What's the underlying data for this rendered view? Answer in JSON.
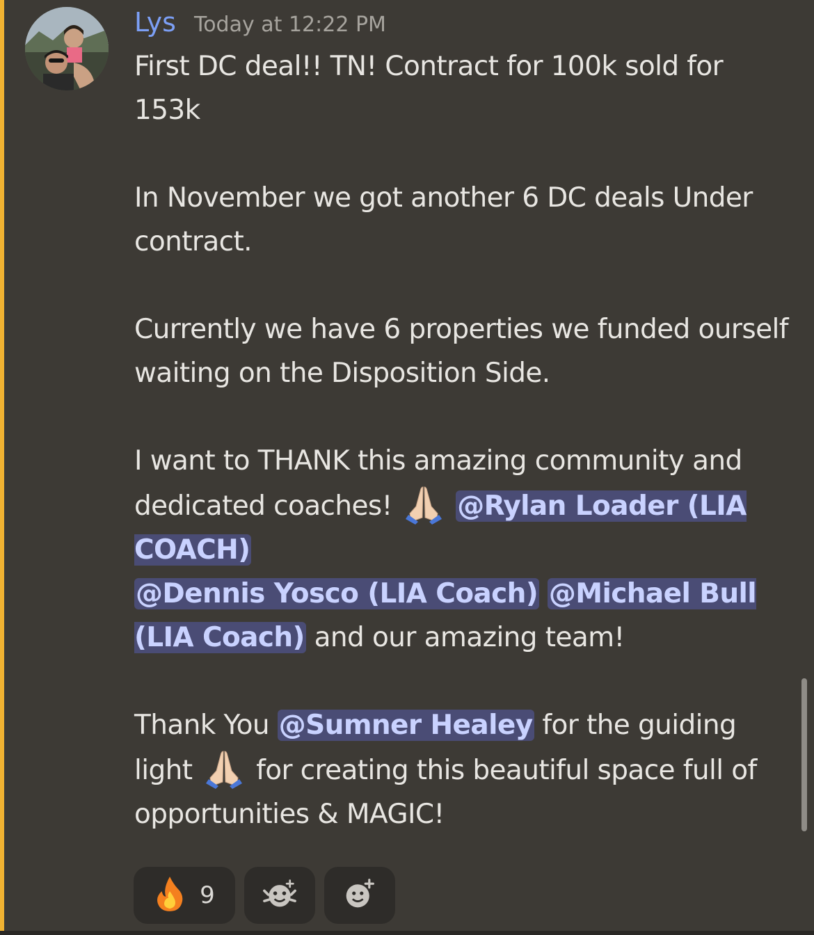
{
  "message": {
    "username": "Lys",
    "timestamp": "Today at 12:22 PM",
    "paragraphs": {
      "p1": "First DC deal!! TN! Contract for 100k sold for 153k",
      "p2": "In November we got another 6 DC deals Under contract.",
      "p3": "Currently we have 6 properties we funded ourself waiting on the Disposition Side.",
      "p4_part1": "I want to THANK this amazing community and dedicated coaches!",
      "p4_part2": "and our amazing team!",
      "p5_part1": "Thank You",
      "p5_part2": "for the guiding light",
      "p5_part3": "for creating this beautiful space full of opportunities & MAGIC!"
    },
    "mentions": {
      "rylan": "@Rylan Loader (LIA COACH)",
      "dennis": "@Dennis Yosco (LIA Coach)",
      "michael": "@Michael Bull (LIA Coach)",
      "sumner": "@Sumner Healey"
    }
  },
  "reactions": [
    {
      "icon": "fire-icon",
      "count": "9"
    },
    {
      "icon": "add-super-reaction-icon"
    },
    {
      "icon": "add-reaction-icon"
    }
  ],
  "colors": {
    "background": "#3d3a35",
    "accent_bar": "#f0b232",
    "username": "#7c9ff5",
    "mention_bg": "#4a4c75",
    "mention_text": "#c9d2ff"
  }
}
